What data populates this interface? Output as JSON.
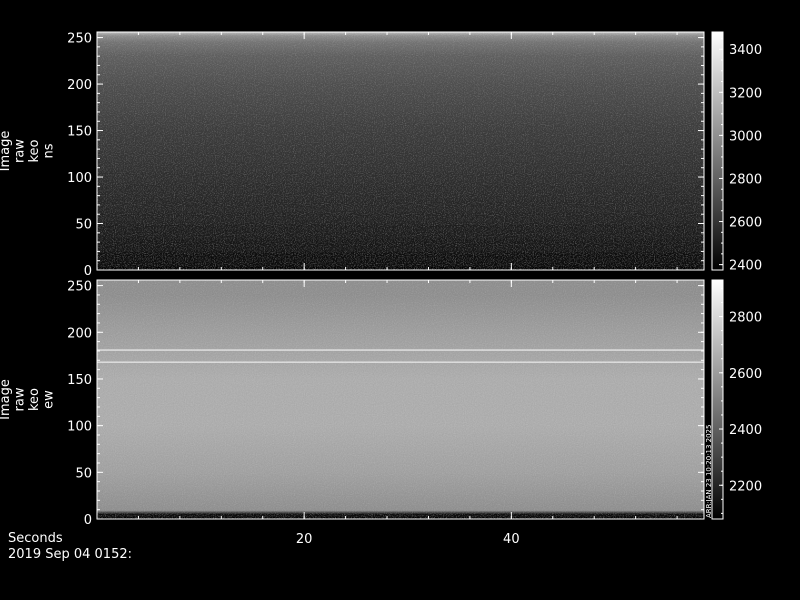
{
  "chart_data": [
    {
      "type": "heatmap",
      "ylabel": [
        "Image",
        "raw",
        "keo",
        "ns"
      ],
      "ylim": [
        0,
        256
      ],
      "yticks": [
        0,
        50,
        100,
        150,
        200,
        250
      ],
      "xlim": [
        0,
        58.6
      ],
      "xticks_labeled": [
        20,
        40
      ],
      "colorbar": {
        "range": [
          2375,
          3480
        ],
        "ticks": [
          2400,
          2600,
          2800,
          3000,
          3200,
          3400
        ]
      },
      "profile": [
        {
          "y": 0,
          "value": 2390
        },
        {
          "y": 10,
          "value": 2430
        },
        {
          "y": 30,
          "value": 2480
        },
        {
          "y": 60,
          "value": 2530
        },
        {
          "y": 100,
          "value": 2580
        },
        {
          "y": 150,
          "value": 2640
        },
        {
          "y": 200,
          "value": 2720
        },
        {
          "y": 230,
          "value": 2790
        },
        {
          "y": 245,
          "value": 2880
        },
        {
          "y": 252,
          "value": 3000
        },
        {
          "y": 256,
          "value": 3200
        }
      ],
      "lines": []
    },
    {
      "type": "heatmap",
      "ylabel": [
        "Image",
        "raw",
        "keo",
        "ew"
      ],
      "ylim": [
        0,
        256
      ],
      "yticks": [
        0,
        50,
        100,
        150,
        200,
        250
      ],
      "xlim": [
        0,
        58.6
      ],
      "xticks_labeled": [
        20,
        40
      ],
      "colorbar": {
        "range": [
          2080,
          2930
        ],
        "ticks": [
          2200,
          2400,
          2600,
          2800
        ]
      },
      "profile": [
        {
          "y": 0,
          "value": 2090
        },
        {
          "y": 5,
          "value": 2120
        },
        {
          "y": 9,
          "value": 2560
        },
        {
          "y": 50,
          "value": 2620
        },
        {
          "y": 100,
          "value": 2660
        },
        {
          "y": 150,
          "value": 2660
        },
        {
          "y": 200,
          "value": 2610
        },
        {
          "y": 240,
          "value": 2560
        },
        {
          "y": 256,
          "value": 2560
        }
      ],
      "lines": [
        {
          "y": 168,
          "value": 2870
        },
        {
          "y": 181,
          "value": 2880
        }
      ]
    }
  ],
  "sidebar_stamp": "ARR:JAN 23 10:20:13 2025",
  "footer": {
    "xaxis_label": "Seconds",
    "timestamp": "2019 Sep 04 0152:"
  }
}
